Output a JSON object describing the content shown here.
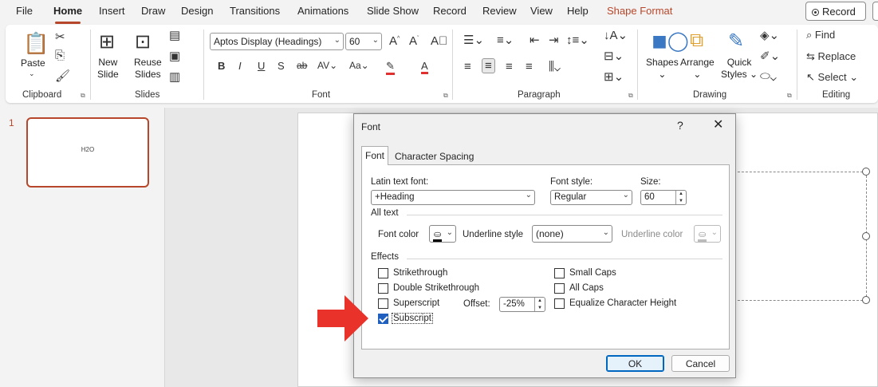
{
  "tabs": [
    {
      "label": "File"
    },
    {
      "label": "Home"
    },
    {
      "label": "Insert"
    },
    {
      "label": "Draw"
    },
    {
      "label": "Design"
    },
    {
      "label": "Transitions"
    },
    {
      "label": "Animations"
    },
    {
      "label": "Slide Show"
    },
    {
      "label": "Record"
    },
    {
      "label": "Review"
    },
    {
      "label": "View"
    },
    {
      "label": "Help"
    },
    {
      "label": "Shape Format"
    }
  ],
  "record_button": "Record",
  "ribbon": {
    "clipboard": {
      "group": "Clipboard",
      "paste": "Paste"
    },
    "slides": {
      "group": "Slides",
      "new_slide_1": "New",
      "new_slide_2": "Slide",
      "reuse_1": "Reuse",
      "reuse_2": "Slides"
    },
    "font": {
      "group": "Font",
      "font_name": "Aptos Display (Headings)",
      "font_size": "60"
    },
    "paragraph": {
      "group": "Paragraph"
    },
    "drawing": {
      "group": "Drawing",
      "shapes": "Shapes",
      "arrange": "Arrange",
      "quick_1": "Quick",
      "quick_2": "Styles"
    },
    "editing": {
      "group": "Editing",
      "find": "Find",
      "replace": "Replace",
      "select": "Select"
    }
  },
  "slide_panel": {
    "number": "1",
    "thumb_text": "H2O"
  },
  "dialog": {
    "title": "Font",
    "help": "?",
    "close": "✕",
    "tabs": [
      "Font",
      "Character Spacing"
    ],
    "latin_label": "Latin text font:",
    "latin_value": "+Heading",
    "style_label": "Font style:",
    "style_value": "Regular",
    "size_label": "Size:",
    "size_value": "60",
    "all_text": "All text",
    "font_color_label": "Font color",
    "underline_style_label": "Underline style",
    "underline_style_value": "(none)",
    "underline_color_label": "Underline color",
    "effects": "Effects",
    "strikethrough": "Strikethrough",
    "double_strikethrough": "Double Strikethrough",
    "superscript": "Superscript",
    "subscript": "Subscript",
    "offset_label": "Offset:",
    "offset_value": "-25%",
    "small_caps": "Small Caps",
    "all_caps": "All Caps",
    "equalize": "Equalize Character Height",
    "ok": "OK",
    "cancel": "Cancel"
  },
  "colors": {
    "accent": "#b7472a",
    "checkbox": "#1f5fbf",
    "arrow": "#e8322a"
  }
}
